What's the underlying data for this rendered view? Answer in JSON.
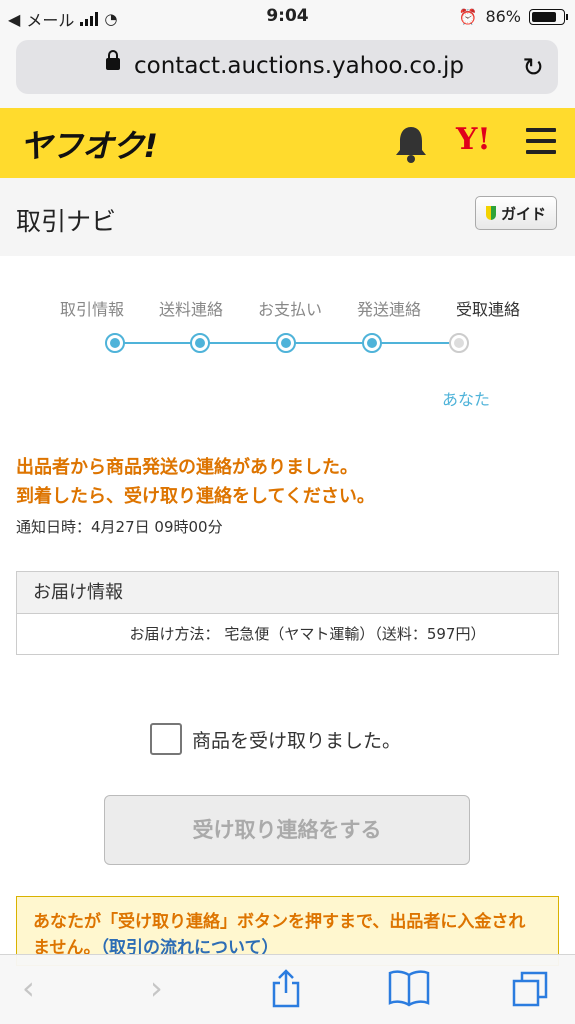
{
  "status": {
    "carrier": "メール",
    "time": "9:04",
    "battery": "86%",
    "battery_level": 0.86
  },
  "browser": {
    "url": "contact.auctions.yahoo.co.jp"
  },
  "header": {
    "logo": "ヤフオク!",
    "yahoo_mark": "Y!"
  },
  "page": {
    "title": "取引ナビ",
    "guide_label": "ガイド"
  },
  "steps": {
    "labels": [
      "取引情報",
      "送料連絡",
      "お支払い",
      "発送連絡",
      "受取連絡"
    ],
    "current_owner": "あなた"
  },
  "message": {
    "line1": "出品者から商品発送の連絡がありました。",
    "line2": "到着したら、受け取り連絡をしてください。",
    "notice_date": "通知日時：4月27日 09時00分"
  },
  "delivery": {
    "heading": "お届け情報",
    "method": "お届け方法： 宅急便（ヤマト運輸）（送料：597円）"
  },
  "receipt": {
    "checkbox_label": "商品を受け取りました。",
    "submit_label": "受け取り連絡をする"
  },
  "warning": {
    "text": "あなたが「受け取り連絡」ボタンを押すまで、出品者に入金されません。",
    "link": "（取引の流れについて）"
  },
  "colors": {
    "header_yellow": "#ffdb2d",
    "accent_blue": "#4fb3d9",
    "message_orange": "#dd7400",
    "link_blue": "#2d6db5"
  }
}
